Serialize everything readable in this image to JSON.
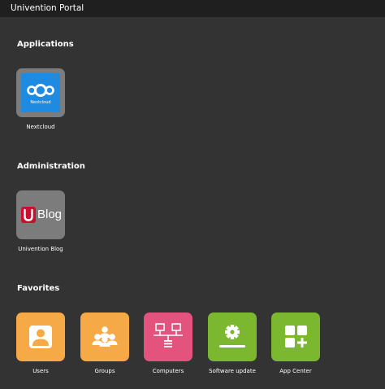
{
  "header": {
    "title": "Univention Portal"
  },
  "sections": {
    "applications": {
      "title": "Applications",
      "tiles": [
        {
          "label": "Nextcloud",
          "icon": "nextcloud-logo-icon",
          "icon_text": "Nextcloud",
          "color": "#7c7c7c"
        }
      ]
    },
    "administration": {
      "title": "Administration",
      "tiles": [
        {
          "label": "Univention Blog",
          "icon": "univention-blog-logo-icon",
          "icon_text": "Blog",
          "color": "#7c7c7c"
        }
      ]
    },
    "favorites": {
      "title": "Favorites",
      "tiles": [
        {
          "label": "Users",
          "icon": "user-icon",
          "color": "#f5a947"
        },
        {
          "label": "Groups",
          "icon": "group-icon",
          "color": "#f5a947"
        },
        {
          "label": "Computers",
          "icon": "network-computers-icon",
          "color": "#e4527e"
        },
        {
          "label": "Software update",
          "icon": "gear-progress-icon",
          "color": "#7cb82f"
        },
        {
          "label": "App Center",
          "icon": "app-grid-plus-icon",
          "color": "#7cb82f"
        }
      ]
    }
  },
  "colors": {
    "background": "#333333",
    "topbar": "#1f1f1f",
    "nextcloud_blue": "#1e8be0",
    "univention_red": "#c8102e"
  }
}
